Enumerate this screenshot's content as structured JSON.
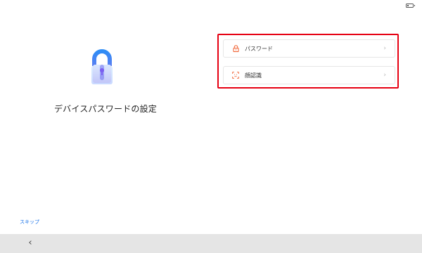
{
  "status": {
    "battery_level": 0.35
  },
  "page": {
    "title": "デバイスパスワードの設定"
  },
  "options": [
    {
      "label": "パスワード",
      "icon": "lock-icon",
      "chevron": "›"
    },
    {
      "label": "顔認識",
      "icon": "face-recognition-icon",
      "chevron": "›"
    }
  ],
  "footer": {
    "skip_label": "スキップ"
  },
  "nav": {
    "back_glyph": "‹"
  },
  "colors": {
    "highlight": "#e60012",
    "icon_accent": "#f05a28",
    "link": "#1a73e8",
    "nav_bg": "#e5e5e5"
  }
}
